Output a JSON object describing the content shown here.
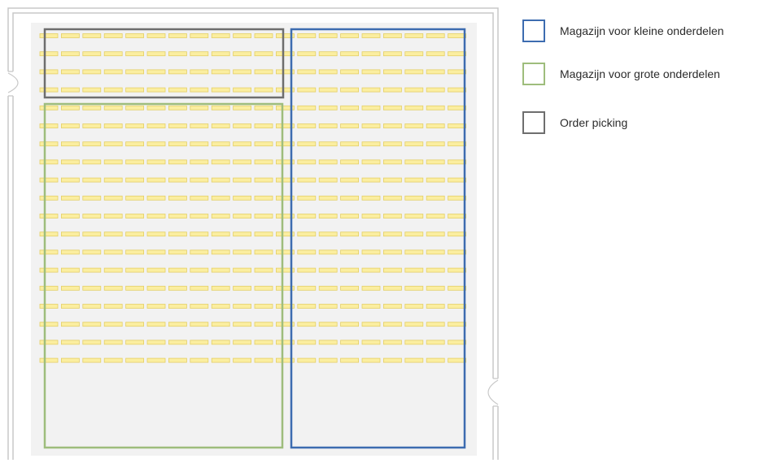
{
  "legend": [
    {
      "label": "Magazijn voor kleine onderdelen",
      "color": "#3d6cb0"
    },
    {
      "label": "Magazijn voor grote onderdelen",
      "color": "#9ebd7c"
    },
    {
      "label": "Order picking",
      "color": "#6e6e6e"
    }
  ],
  "floor": {
    "rack_rows": 19,
    "racks_per_row": 20,
    "colors": {
      "wall": "#c8c8c8",
      "floor": "#f2f2f2",
      "rack_fill": "#fbeea0",
      "rack_stroke": "#e4cf66"
    }
  },
  "zones": [
    {
      "id": "small-parts",
      "color": "#3d6cb0"
    },
    {
      "id": "large-parts",
      "color": "#9ebd7c"
    },
    {
      "id": "order-picking",
      "color": "#6e6e6e"
    }
  ]
}
